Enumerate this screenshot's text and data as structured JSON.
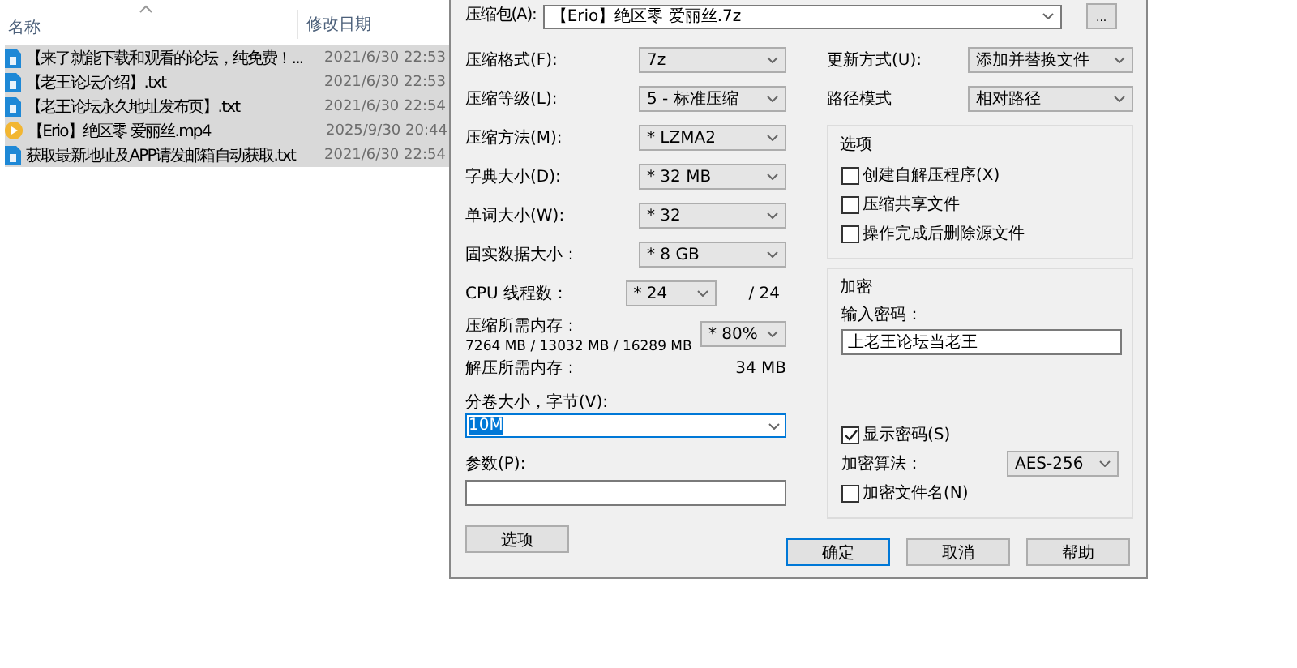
{
  "explorer": {
    "columns": [
      {
        "label": "名称"
      },
      {
        "label": "修改日期"
      }
    ],
    "files": [
      {
        "name": "【来了就能下载和观看的论坛，纯免费！...",
        "modified": "2021/6/30 22:53",
        "kind": "text",
        "selected": true
      },
      {
        "name": "【老王论坛介绍】.txt",
        "modified": "2021/6/30 22:53",
        "kind": "text",
        "selected": true
      },
      {
        "name": "【老王论坛永久地址发布页】.txt",
        "modified": "2021/6/30 22:54",
        "kind": "text",
        "selected": true
      },
      {
        "name": "【Erio】绝区零 爱丽丝.mp4",
        "modified": "2025/9/30 20:44",
        "kind": "video",
        "selected": true
      },
      {
        "name": "获取最新地址及APP请发邮箱自动获取.txt",
        "modified": "2021/6/30 22:54",
        "kind": "text",
        "selected": true
      }
    ]
  },
  "dialog": {
    "archive": {
      "label": "压缩包(A):",
      "value": "【Erio】绝区零 爱丽丝.7z",
      "browse": "..."
    },
    "settings": [
      {
        "label": "压缩格式(F):",
        "value": "7z"
      },
      {
        "label": "压缩等级(L):",
        "value": "5 - 标准压缩"
      },
      {
        "label": "压缩方法(M):",
        "value": "* LZMA2"
      },
      {
        "label": "字典大小(D):",
        "value": "* 32 MB"
      },
      {
        "label": "单词大小(W):",
        "value": "* 32"
      },
      {
        "label": "固实数据大小：",
        "value": "* 8 GB"
      }
    ],
    "cpu": {
      "label": "CPU 线程数：",
      "value": "* 24",
      "max": "/ 24"
    },
    "memory": {
      "label": "压缩所需内存：",
      "detail": "7264 MB / 13032 MB / 16289 MB",
      "value": "* 80%"
    },
    "decompress_memory": {
      "label": "解压所需内存：",
      "value": "34 MB"
    },
    "split": {
      "label": "分卷大小，字节(V):",
      "value": "10M"
    },
    "params": {
      "label": "参数(P):"
    },
    "options_button": "选项",
    "update_mode": {
      "label": "更新方式(U):",
      "value": "添加并替换文件"
    },
    "path_mode": {
      "label": "路径模式",
      "value": "相对路径"
    },
    "options": {
      "title": "选项",
      "items": [
        {
          "label": "创建自解压程序(X)",
          "checked": false
        },
        {
          "label": "压缩共享文件",
          "checked": false
        },
        {
          "label": "操作完成后删除源文件",
          "checked": false
        }
      ]
    },
    "encryption": {
      "title": "加密",
      "password_label": "输入密码：",
      "password": "上老王论坛当老王",
      "show_password": {
        "label": "显示密码(S)",
        "checked": true
      },
      "method_label": "加密算法：",
      "method": "AES-256",
      "encrypt_names": {
        "label": "加密文件名(N)",
        "checked": false
      }
    },
    "buttons": [
      {
        "label": "确定",
        "default": true
      },
      {
        "label": "取消",
        "default": false
      },
      {
        "label": "帮助",
        "default": false
      }
    ]
  }
}
